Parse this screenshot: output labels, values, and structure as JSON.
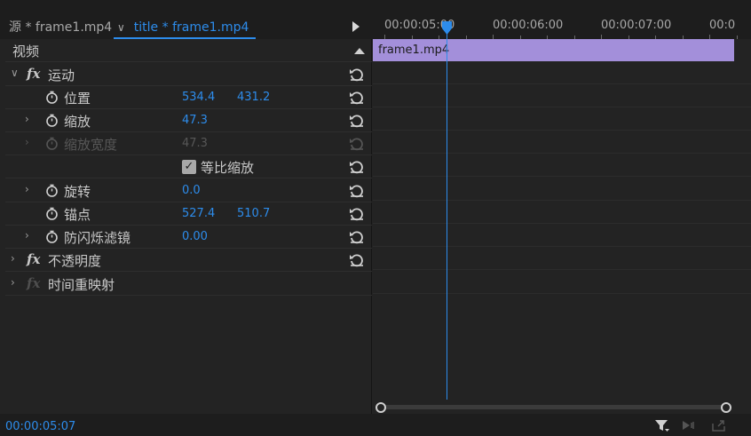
{
  "tabs": {
    "source_label": "源 * frame1.mp4",
    "title_label": "title * frame1.mp4"
  },
  "ruler": {
    "labels": [
      "00:00:05:00",
      "00:00:06:00",
      "00:00:07:00",
      "00:0"
    ]
  },
  "effects": {
    "header_label": "视频",
    "motion": {
      "label": "运动",
      "position": {
        "label": "位置",
        "x": "534.4",
        "y": "431.2"
      },
      "scale": {
        "label": "缩放",
        "value": "47.3"
      },
      "scale_width": {
        "label": "缩放宽度",
        "value": "47.3"
      },
      "uniform_scale": {
        "label": "等比缩放",
        "checked": true
      },
      "rotation": {
        "label": "旋转",
        "value": "0.0"
      },
      "anchor": {
        "label": "锚点",
        "x": "527.4",
        "y": "510.7"
      },
      "anti_flicker": {
        "label": "防闪烁滤镜",
        "value": "0.00"
      }
    },
    "opacity": {
      "label": "不透明度"
    },
    "time_remap": {
      "label": "时间重映射"
    }
  },
  "timeline": {
    "clip_name": "frame1.mp4"
  },
  "footer": {
    "timecode": "00:00:05:07"
  },
  "colors": {
    "accent": "#2d8ceb",
    "clip": "#a38fda",
    "panel": "#232323"
  }
}
